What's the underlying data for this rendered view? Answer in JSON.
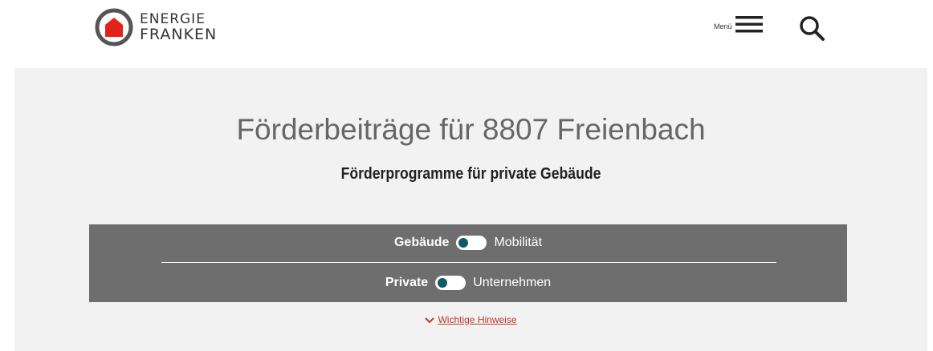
{
  "header": {
    "logo_line1": "ENERGIE",
    "logo_line2": "FRANKEN",
    "menu_label": "Menü",
    "icons": [
      "house-logo-icon",
      "hamburger-menu-icon",
      "search-icon"
    ]
  },
  "hero": {
    "title": "Förderbeiträge für 8807 Freienbach",
    "subtitle": "Förderprogramme für private Gebäude"
  },
  "toggles": [
    {
      "left": "Gebäude",
      "right": "Mobilität"
    },
    {
      "left": "Private",
      "right": "Unternehmen"
    }
  ],
  "hint": {
    "label": "Wichtige Hinweise"
  },
  "colors": {
    "accent": "#e2231a",
    "panel": "#6e6e6e",
    "toggle_knob": "#0f5a64",
    "hero_bg": "#f2f2f2"
  }
}
